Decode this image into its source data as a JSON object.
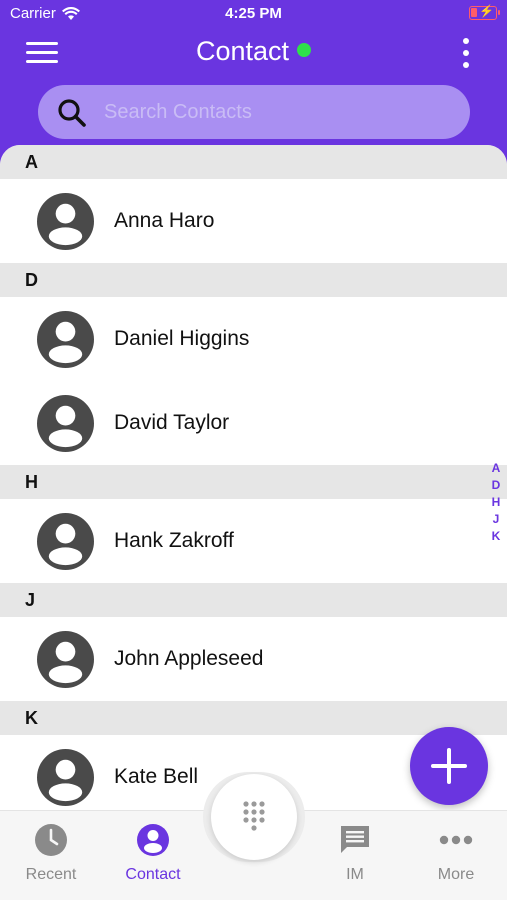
{
  "status_bar": {
    "carrier": "Carrier",
    "time": "4:25 PM"
  },
  "header": {
    "title": "Contact",
    "online_color": "#2fe04a",
    "accent": "#6a35e0"
  },
  "search": {
    "placeholder": "Search Contacts",
    "value": ""
  },
  "sections": [
    {
      "letter": "A",
      "contacts": [
        "Anna Haro"
      ]
    },
    {
      "letter": "D",
      "contacts": [
        "Daniel Higgins",
        "David Taylor"
      ]
    },
    {
      "letter": "H",
      "contacts": [
        "Hank Zakroff"
      ]
    },
    {
      "letter": "J",
      "contacts": [
        "John Appleseed"
      ]
    },
    {
      "letter": "K",
      "contacts": [
        "Kate Bell"
      ]
    }
  ],
  "index_letters": [
    "A",
    "D",
    "H",
    "J",
    "K"
  ],
  "tabs": [
    {
      "label": "Recent",
      "icon": "clock-icon",
      "active": false
    },
    {
      "label": "Contact",
      "icon": "person-icon",
      "active": true
    },
    {
      "label": "IM",
      "icon": "chat-icon",
      "active": false
    },
    {
      "label": "More",
      "icon": "more-icon",
      "active": false
    }
  ],
  "fab_icon": "plus-icon",
  "dialpad_icon": "dialpad-icon"
}
